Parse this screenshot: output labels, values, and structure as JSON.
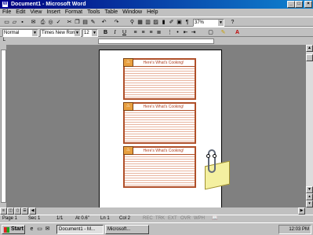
{
  "window": {
    "title": "Document1 - Microsoft Word",
    "app_icon": "W"
  },
  "menu": [
    "File",
    "Edit",
    "View",
    "Insert",
    "Format",
    "Tools",
    "Table",
    "Window",
    "Help"
  ],
  "toolbar_standard": {
    "zoom": "37%"
  },
  "toolbar_formatting": {
    "style": "Normal",
    "font": "Times New Roman",
    "size": "12",
    "bold": "B",
    "italic": "I",
    "underline": "U"
  },
  "document": {
    "cards": [
      {
        "header": "Here's What's Cooking!"
      },
      {
        "header": "Here's What's Cooking!"
      },
      {
        "header": "Here's What's Cooking!"
      }
    ]
  },
  "status": {
    "page": "Page 1",
    "section": "Sec 1",
    "page_of": "1/1",
    "at": "At 0.6\"",
    "line": "Ln 1",
    "col": "Col 2",
    "rec": "REC",
    "trk": "TRK",
    "ext": "EXT",
    "ovr": "OVR",
    "wph": "WPH"
  },
  "taskbar": {
    "start": "Start",
    "items": [
      "Document1 - M...",
      "Microsoft..."
    ],
    "clock": "12:03 PM"
  }
}
